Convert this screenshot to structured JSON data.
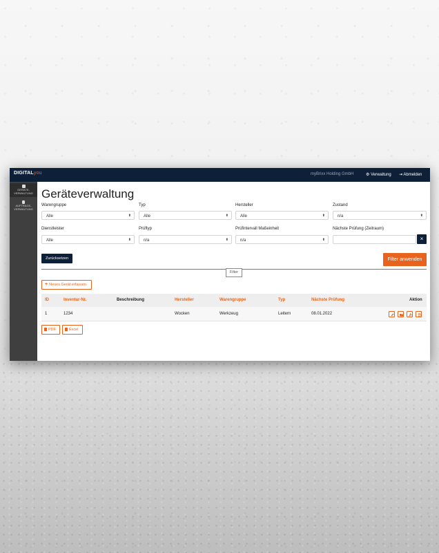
{
  "header": {
    "logo_main": "DIGITAL",
    "logo_accent": "you",
    "company": "myBrixx Holding GmbH",
    "admin_label": "Verwaltung",
    "logout_label": "Abmelden"
  },
  "sidebar": {
    "items": [
      {
        "label_line1": "GERÄTE-",
        "label_line2": "VERWALTUNG",
        "icon": "database-icon"
      },
      {
        "label_line1": "AUFTRAGS-",
        "label_line2": "VERWALTUNG",
        "icon": "clipboard-icon"
      }
    ]
  },
  "page": {
    "title": "Geräteverwaltung"
  },
  "filters": {
    "warengruppe": {
      "label": "Warengruppe",
      "value": "Alle"
    },
    "typ": {
      "label": "Typ",
      "value": "Alle"
    },
    "hersteller": {
      "label": "Hersteller",
      "value": "Alle"
    },
    "zustand": {
      "label": "Zustand",
      "value": "n/a"
    },
    "dienstleister": {
      "label": "Dienstleister",
      "value": "Alle"
    },
    "prueftyp": {
      "label": "Prüftyp",
      "value": "n/a"
    },
    "pruefintervall": {
      "label": "Prüfintervall Maßeinheit",
      "value": "n/a"
    },
    "naechste": {
      "label": "Nächste Prüfung (Zeitraum)",
      "value": ""
    },
    "clear": "×",
    "reset_label": "Zurücksetzen",
    "apply_label": "Filter anwenden",
    "filter_tab": "Filter"
  },
  "actions": {
    "new_device": "Neues Gerät erfassen",
    "pdf": "PDF",
    "excel": "Excel"
  },
  "table": {
    "columns": [
      "ID",
      "Inventar-Nr.",
      "Beschreibung",
      "Hersteller",
      "Warengruppe",
      "Typ",
      "Nächste Prüfung",
      "Aktion"
    ],
    "rows": [
      {
        "id": "1",
        "inventar": "1234",
        "beschreibung": "",
        "hersteller": "Wocken",
        "warengruppe": "Werkzeug",
        "typ": "Leitern",
        "naechste": "08.01.2022"
      }
    ]
  },
  "colors": {
    "navy": "#0e1f38",
    "accent": "#e8641e",
    "sidebar": "#3f3f3f"
  }
}
